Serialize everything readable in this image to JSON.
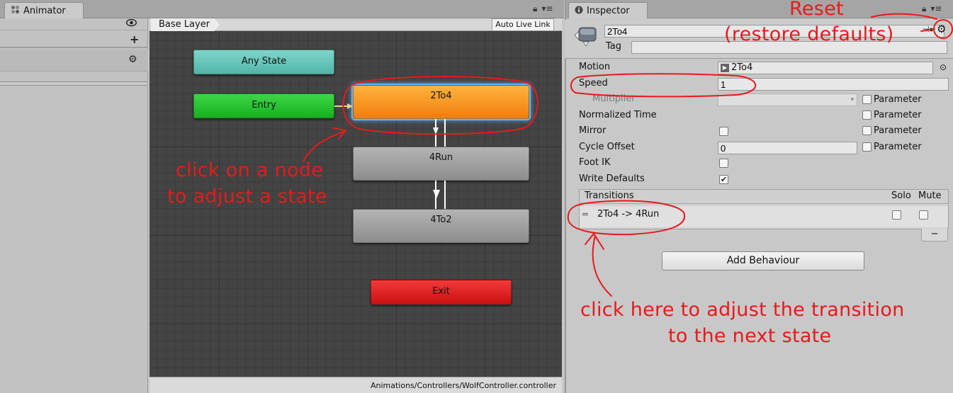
{
  "animator": {
    "tab_label": "Animator",
    "breadcrumb": "Base Layer",
    "auto_live_link": "Auto Live Link",
    "footer_path": "Animations/Controllers/WolfController.controller",
    "nodes": {
      "any_state": "Any State",
      "entry": "Entry",
      "state_2to4": "2To4",
      "state_4run": "4Run",
      "state_4to2": "4To2",
      "exit": "Exit"
    },
    "colors": {
      "any_state": "#5fc4b6",
      "entry": "#22c32b",
      "selected_state": "#f5951f",
      "default_state": "#a0a0a0",
      "exit": "#e01e1e",
      "selection_glow": "#5fb6ff"
    }
  },
  "inspector": {
    "tab_label": "Inspector",
    "state_name": "2To4",
    "tag_label": "Tag",
    "tag_value": "",
    "motion_label": "Motion",
    "motion_value": "2To4",
    "speed_label": "Speed",
    "speed_value": "1",
    "multiplier_label": "Multiplier",
    "normalized_time_label": "Normalized Time",
    "mirror_label": "Mirror",
    "mirror_checked": false,
    "cycle_offset_label": "Cycle Offset",
    "cycle_offset_value": "0",
    "foot_ik_label": "Foot IK",
    "foot_ik_checked": false,
    "write_defaults_label": "Write Defaults",
    "write_defaults_checked": true,
    "parameter_label": "Parameter",
    "transitions": {
      "header": "Transitions",
      "solo_label": "Solo",
      "mute_label": "Mute",
      "items": [
        {
          "label": "2To4 -> 4Run",
          "solo": false,
          "mute": false
        }
      ],
      "remove_label": "−"
    },
    "add_behaviour_label": "Add Behaviour"
  },
  "annotations": {
    "reset_title": "Reset",
    "reset_subtitle": "(restore defaults)",
    "node_hint_line1": "click on a node",
    "node_hint_line2": "to adjust a state",
    "transition_hint_line1": "click here to adjust the transition",
    "transition_hint_line2": "to the next state",
    "color": "#e8191b"
  },
  "icons": {
    "animator_tab": "animator-icon",
    "inspector_tab": "info-icon",
    "eye": "eye-icon",
    "plus": "plus-icon",
    "gear": "gear-icon",
    "lock": "lock-icon",
    "menu": "menu-icon",
    "state": "state-icon",
    "motion_clip": "animation-clip-icon",
    "object_picker": "object-picker-icon",
    "drag_handle": "drag-handle-icon"
  }
}
